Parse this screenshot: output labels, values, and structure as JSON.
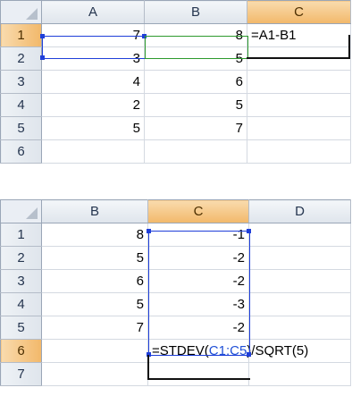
{
  "sheet1": {
    "columns": [
      {
        "label": "A",
        "selected": false
      },
      {
        "label": "B",
        "selected": false
      },
      {
        "label": "C",
        "selected": true
      }
    ],
    "rows": [
      {
        "label": "1",
        "selected": true,
        "cells": [
          "7",
          "8",
          "=A1-B1"
        ]
      },
      {
        "label": "2",
        "selected": false,
        "cells": [
          "3",
          "5",
          ""
        ]
      },
      {
        "label": "3",
        "selected": false,
        "cells": [
          "4",
          "6",
          ""
        ]
      },
      {
        "label": "4",
        "selected": false,
        "cells": [
          "2",
          "5",
          ""
        ]
      },
      {
        "label": "5",
        "selected": false,
        "cells": [
          "5",
          "7",
          ""
        ]
      },
      {
        "label": "6",
        "selected": false,
        "cells": [
          "",
          "",
          ""
        ]
      }
    ]
  },
  "sheet2": {
    "columns": [
      {
        "label": "B",
        "selected": false
      },
      {
        "label": "C",
        "selected": true
      },
      {
        "label": "D",
        "selected": false
      }
    ],
    "rows": [
      {
        "label": "1",
        "selected": false,
        "cells": [
          "8",
          "-1",
          ""
        ]
      },
      {
        "label": "2",
        "selected": false,
        "cells": [
          "5",
          "-2",
          ""
        ]
      },
      {
        "label": "3",
        "selected": false,
        "cells": [
          "6",
          "-2",
          ""
        ]
      },
      {
        "label": "4",
        "selected": false,
        "cells": [
          "5",
          "-3",
          ""
        ]
      },
      {
        "label": "5",
        "selected": false,
        "cells": [
          "7",
          "-2",
          ""
        ]
      },
      {
        "label": "6",
        "selected": true,
        "cells": [
          "",
          "",
          ""
        ]
      },
      {
        "label": "7",
        "selected": false,
        "cells": [
          "",
          "",
          ""
        ]
      }
    ],
    "formula": {
      "prefix": "=STDEV(",
      "range": "C1:C5",
      "suffix": ")/SQRT(5)"
    }
  },
  "colors": {
    "range_blue": "#1f3fd9",
    "range_green": "#2e9a2e",
    "header_selected": "#f2b86a"
  }
}
